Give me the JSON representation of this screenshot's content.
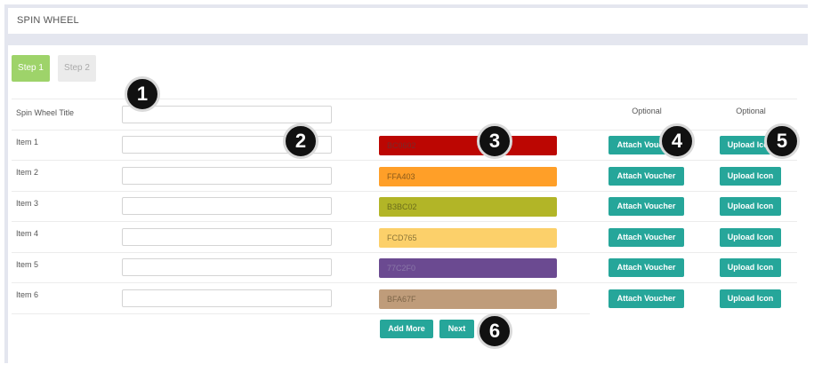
{
  "header": {
    "title": "SPIN WHEEL"
  },
  "steps": [
    {
      "label": "Step 1"
    },
    {
      "label": "Step 2"
    }
  ],
  "form": {
    "title_label": "Spin Wheel Title",
    "optional_label": "Optional",
    "items": [
      {
        "label": "Item 1",
        "color": "BC0602",
        "bg": "#bc0602",
        "text_color": "#7a2a2a"
      },
      {
        "label": "Item 2",
        "color": "FFA403",
        "bg": "#ff9f28",
        "text_color": "#8a5a1a"
      },
      {
        "label": "Item 3",
        "color": "B3BC02",
        "bg": "#b2b527",
        "text_color": "#6b6d1c"
      },
      {
        "label": "Item 4",
        "color": "FCD765",
        "bg": "#fcd06a",
        "text_color": "#8a7438"
      },
      {
        "label": "Item 5",
        "color": "77C2F0",
        "bg": "#6b4a91",
        "text_color": "#8a78a8"
      },
      {
        "label": "Item 6",
        "color": "BFA67F",
        "bg": "#bf9c7a",
        "text_color": "#7c6548"
      }
    ],
    "attach_voucher_label": "Attach Voucher",
    "upload_icon_label": "Upload Icon",
    "add_more_label": "Add More",
    "next_label": "Next"
  },
  "annotations": [
    "1",
    "2",
    "3",
    "4",
    "5",
    "6"
  ]
}
